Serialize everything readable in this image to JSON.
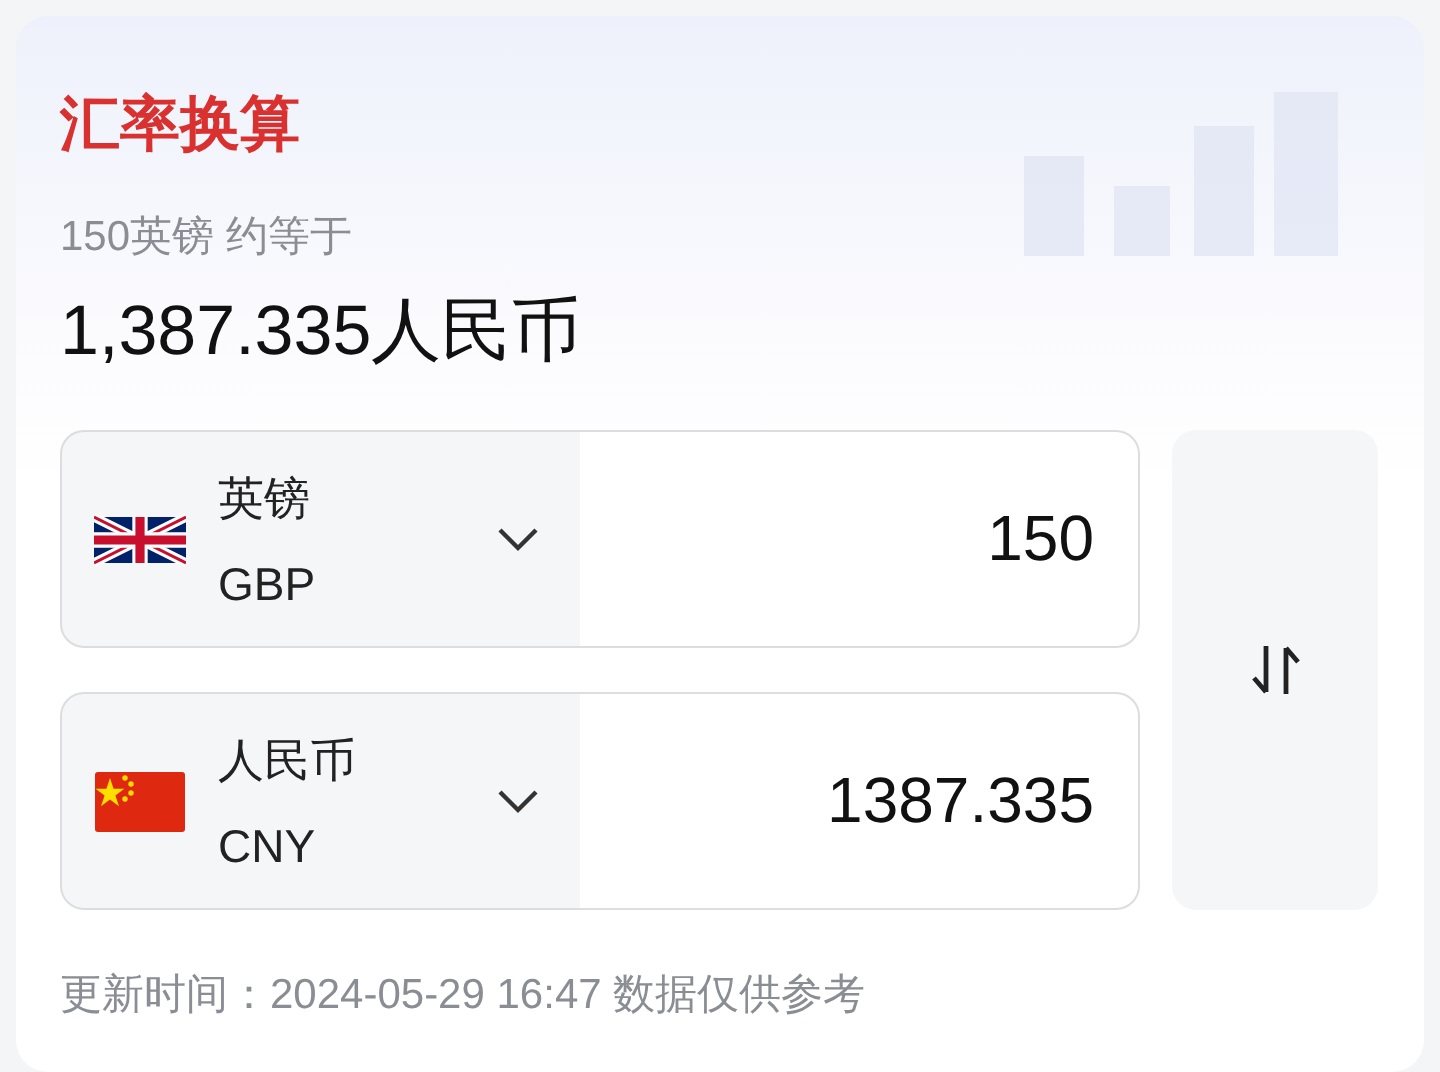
{
  "title": "汇率换算",
  "summary": {
    "amount_line": "150英镑 约等于",
    "result": "1,387.335人民币"
  },
  "currencies": [
    {
      "kind": "uk",
      "name": "英镑",
      "code": "GBP",
      "value": "150"
    },
    {
      "kind": "cn",
      "name": "人民币",
      "code": "CNY",
      "value": "1387.335"
    }
  ],
  "footer": "更新时间：2024-05-29 16:47 数据仅供参考"
}
